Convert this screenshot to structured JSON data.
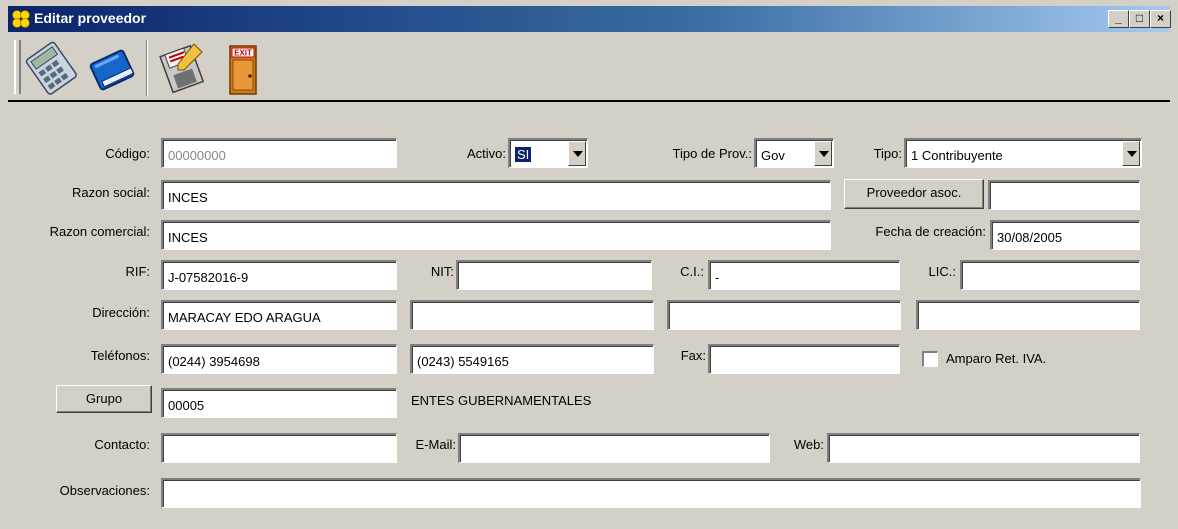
{
  "window": {
    "title": "Editar proveedor"
  },
  "window_controls": {
    "minimize": "_",
    "maximize": "□",
    "close": "×"
  },
  "toolbar": {
    "buttons": [
      {
        "name": "calculator",
        "icon": "calculator-icon"
      },
      {
        "name": "book",
        "icon": "book-icon"
      },
      {
        "name": "save",
        "icon": "save-icon"
      },
      {
        "name": "exit",
        "icon": "exit-door-icon",
        "text": "EXIT"
      }
    ]
  },
  "form": {
    "codigo": {
      "label": "Código:",
      "value": "00000000"
    },
    "activo": {
      "label": "Activo:",
      "value": "SI"
    },
    "tipo_prov": {
      "label": "Tipo de Prov.:",
      "value": "Gov"
    },
    "tipo": {
      "label": "Tipo:",
      "value": "1 Contribuyente"
    },
    "razon_social": {
      "label": "Razon social:",
      "value": "INCES"
    },
    "proveedor_asoc": {
      "button": "Proveedor asoc.",
      "value": ""
    },
    "razon_comercial": {
      "label": "Razon comercial:",
      "value": "INCES"
    },
    "fecha_creacion": {
      "label": "Fecha de creación:",
      "value": "30/08/2005"
    },
    "rif": {
      "label": "RIF:",
      "value": "J-07582016-9"
    },
    "nit": {
      "label": "NIT:",
      "value": ""
    },
    "ci": {
      "label": "C.I.:",
      "value": "-"
    },
    "lic": {
      "label": "LIC.:",
      "value": ""
    },
    "direccion": {
      "label": "Dirección:",
      "values": [
        "MARACAY EDO ARAGUA",
        "",
        "",
        ""
      ]
    },
    "telefonos": {
      "label": "Teléfonos:",
      "values": [
        "(0244) 3954698",
        "(0243) 5549165"
      ]
    },
    "fax": {
      "label": "Fax:",
      "value": ""
    },
    "amparo": {
      "label": "Amparo Ret. IVA.",
      "checked": false
    },
    "grupo": {
      "button": "Grupo",
      "value": "00005",
      "description": "ENTES GUBERNAMENTALES"
    },
    "contacto": {
      "label": "Contacto:",
      "value": ""
    },
    "email": {
      "label": "E-Mail:",
      "value": ""
    },
    "web": {
      "label": "Web:",
      "value": ""
    },
    "observaciones": {
      "label": "Observaciones:",
      "value": ""
    }
  }
}
